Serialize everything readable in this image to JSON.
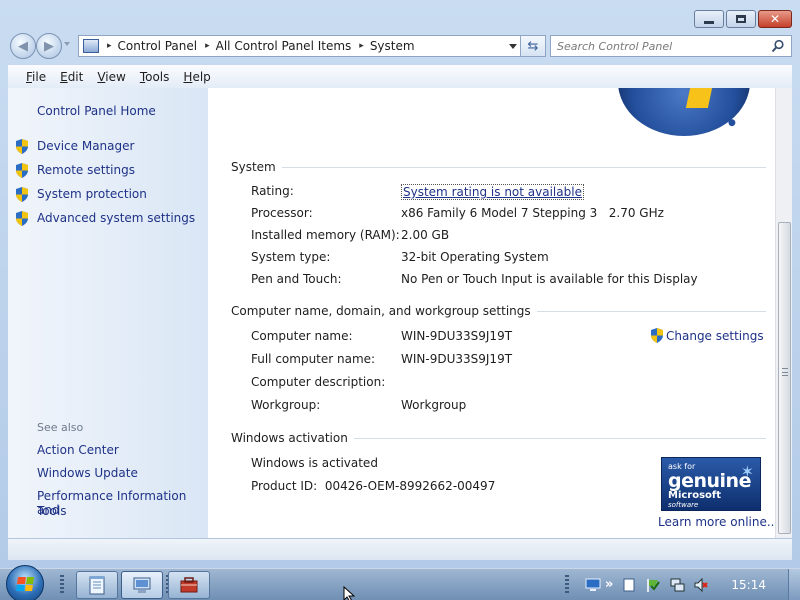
{
  "window": {
    "address": {
      "crumbs": [
        "Control Panel",
        "All Control Panel Items",
        "System"
      ],
      "separator": "▸"
    },
    "search": {
      "placeholder": "Search Control Panel"
    }
  },
  "menu": {
    "items": [
      {
        "label": "File",
        "mnemonic": "F",
        "rest": "ile"
      },
      {
        "label": "Edit",
        "mnemonic": "E",
        "rest": "dit"
      },
      {
        "label": "View",
        "mnemonic": "V",
        "rest": "iew"
      },
      {
        "label": "Tools",
        "mnemonic": "T",
        "rest": "ools"
      },
      {
        "label": "Help",
        "mnemonic": "H",
        "rest": "elp"
      }
    ]
  },
  "sidebar": {
    "home": "Control Panel Home",
    "tasks": [
      "Device Manager",
      "Remote settings",
      "System protection",
      "Advanced system settings"
    ],
    "see_also_title": "See also",
    "see_also": [
      "Action Center",
      "Windows Update",
      "Performance Information and",
      "Tools"
    ]
  },
  "system": {
    "title": "System",
    "rows": [
      {
        "label": "Rating:",
        "value": "System rating is not available"
      },
      {
        "label": "Processor:",
        "value": "x86 Family 6 Model 7 Stepping 3   2.70 GHz"
      },
      {
        "label": "Installed memory (RAM):",
        "value": "2.00 GB"
      },
      {
        "label": "System type:",
        "value": "32-bit Operating System"
      },
      {
        "label": "Pen and Touch:",
        "value": "No Pen or Touch Input is available for this Display"
      }
    ]
  },
  "computer": {
    "title": "Computer name, domain, and workgroup settings",
    "change_settings": "Change settings",
    "rows": [
      {
        "label": "Computer name:",
        "value": "WIN-9DU33S9J19T"
      },
      {
        "label": "Full computer name:",
        "value": "WIN-9DU33S9J19T"
      },
      {
        "label": "Computer description:",
        "value": ""
      },
      {
        "label": "Workgroup:",
        "value": "Workgroup"
      }
    ]
  },
  "activation": {
    "title": "Windows activation",
    "status": "Windows is activated",
    "product_id": "Product ID:  00426-OEM-8992662-00497",
    "badge": {
      "line1": "ask for",
      "line2": "genuine",
      "line3": "Microsoft",
      "line4": "software"
    },
    "learn_more": "Learn more online..."
  },
  "taskbar": {
    "clock": "15:14"
  },
  "colors": {
    "link": "#1e3287",
    "shield_blue": "#2b6cc4",
    "shield_yellow": "#f2c40f"
  }
}
